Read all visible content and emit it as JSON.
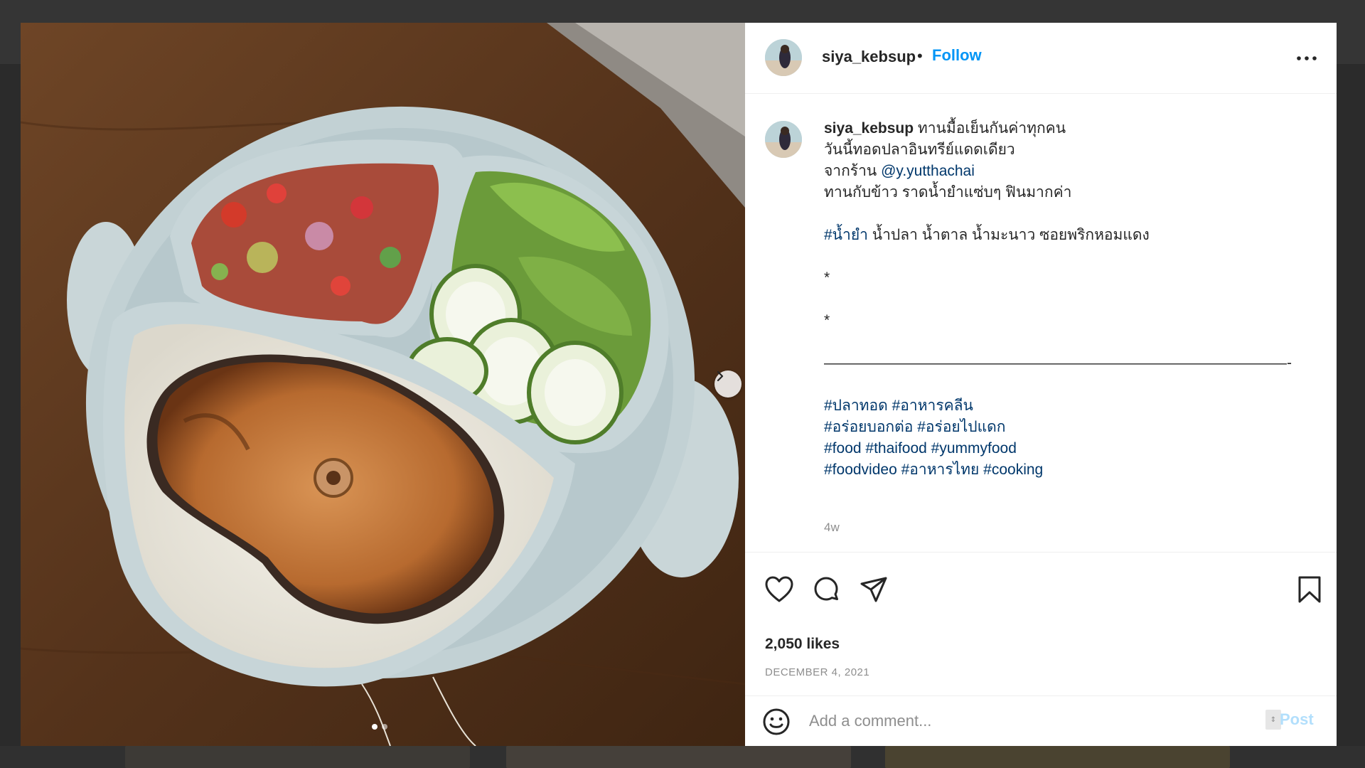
{
  "post": {
    "username": "siya_kebsup",
    "separator": "•",
    "follow_label": "Follow",
    "more_label": "More options"
  },
  "caption": {
    "username": "siya_kebsup",
    "line1": " ทานมื้อเย็นกันค่าทุกคน",
    "line2": "วันนี้ทอดปลาอินทรีย์แดดเดียว",
    "line3_prefix": "จากร้าน ",
    "line3_mention": "@y.yutthachai",
    "line4": "ทานกับข้าว ราดน้ำยำแซ่บๆ ฟินมากค่า",
    "line5_hashtag": "#น้ำยำ",
    "line5_rest": " น้ำปลา น้ำตาล น้ำมะนาว ซอยพริกหอมแดง",
    "star1": "*",
    "star2": "*",
    "divider": "———————————————————————————————-",
    "tags_row1": [
      "#ปลาทอด",
      "#อาหารคลีน"
    ],
    "tags_row2": [
      "#อร่อยบอกต่อ",
      "#อร่อยไปแดก"
    ],
    "tags_row3": [
      "#food",
      "#thaifood",
      "#yummyfood"
    ],
    "tags_row4": [
      "#foodvideo",
      "#อาหารไทย",
      "#cooking"
    ],
    "time": "4w"
  },
  "actions": {
    "like_icon": "heart-icon",
    "comment_icon": "comment-icon",
    "share_icon": "paper-plane-icon",
    "save_icon": "bookmark-icon"
  },
  "likes": "2,050 likes",
  "date": "DECEMBER 4, 2021",
  "comment": {
    "placeholder": "Add a comment...",
    "post_label": "Post"
  },
  "carousel": {
    "current": 1,
    "total": 2
  },
  "colors": {
    "link": "#00376b",
    "follow": "#0095f6",
    "post_disabled": "#b2dffc",
    "muted": "#8e8e8e"
  }
}
